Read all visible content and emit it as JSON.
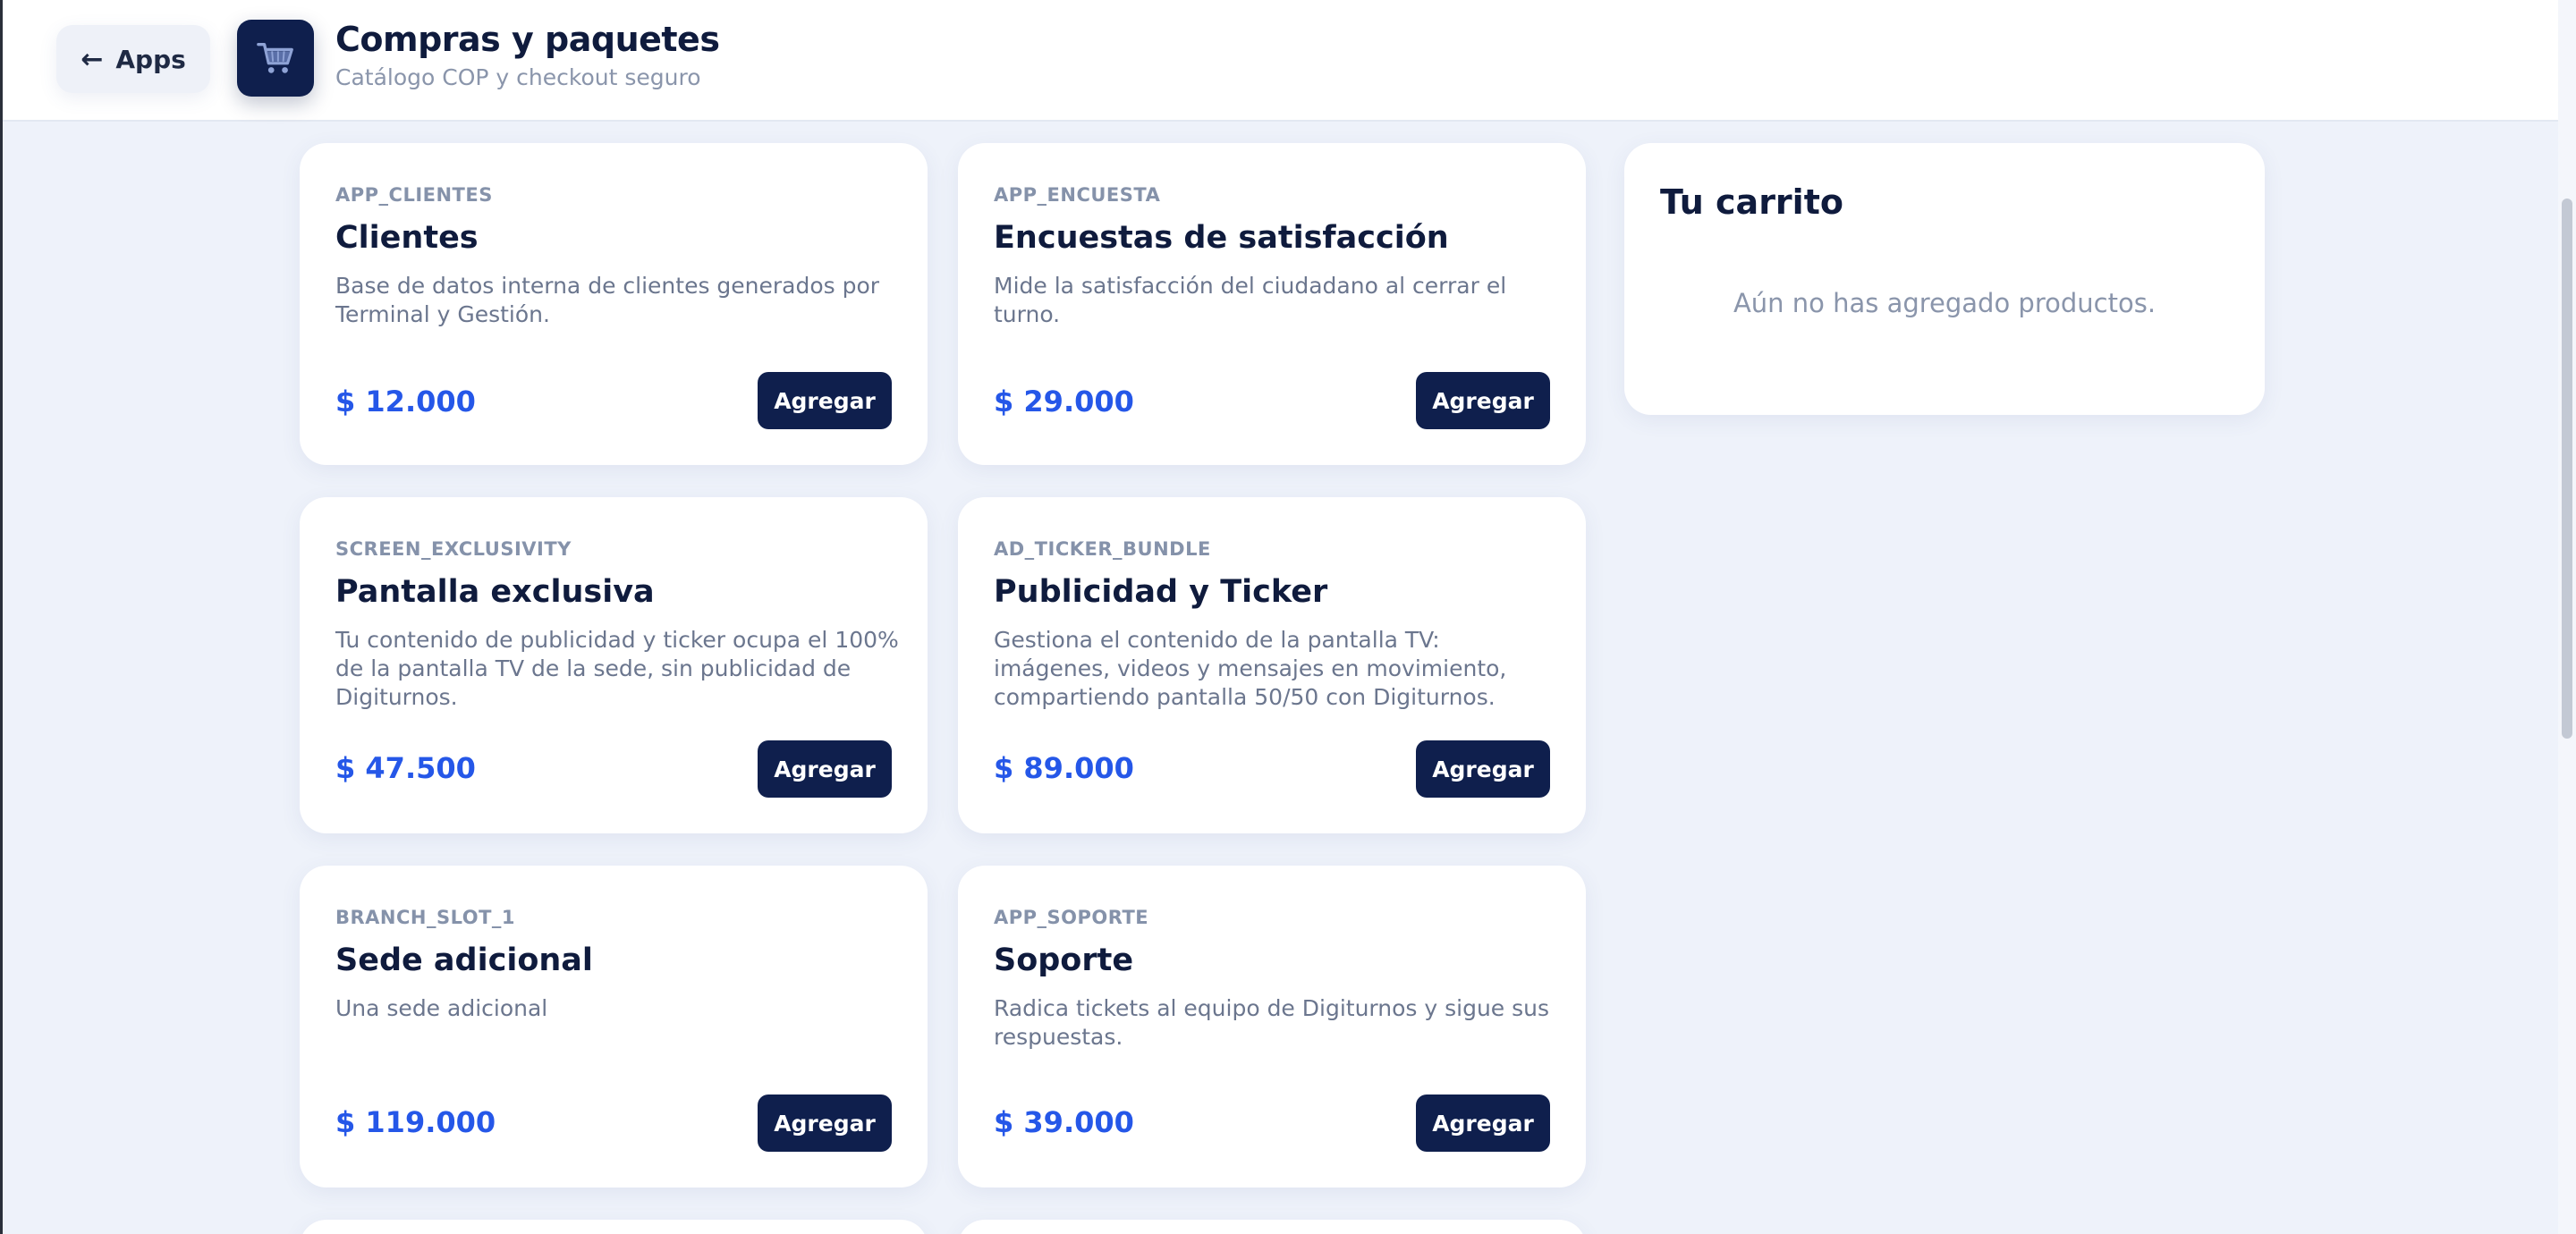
{
  "header": {
    "back_label": "Apps",
    "title": "Compras y paquetes",
    "subtitle": "Catálogo COP y checkout seguro"
  },
  "products": [
    {
      "code": "APP_CLIENTES",
      "name": "Clientes",
      "description": "Base de datos interna de clientes generados por Terminal y Gestión.",
      "price": "$ 12.000",
      "button": "Agregar"
    },
    {
      "code": "APP_ENCUESTA",
      "name": "Encuestas de satisfacción",
      "description": "Mide la satisfacción del ciudadano al cerrar el turno.",
      "price": "$ 29.000",
      "button": "Agregar"
    },
    {
      "code": "SCREEN_EXCLUSIVITY",
      "name": "Pantalla exclusiva",
      "description": "Tu contenido de publicidad y ticker ocupa el 100% de la pantalla TV de la sede, sin publicidad de Digiturnos.",
      "price": "$ 47.500",
      "button": "Agregar"
    },
    {
      "code": "AD_TICKER_BUNDLE",
      "name": "Publicidad y Ticker",
      "description": "Gestiona el contenido de la pantalla TV: imágenes, videos y mensajes en movimiento, compartiendo pantalla 50/50 con Digiturnos.",
      "price": "$ 89.000",
      "button": "Agregar"
    },
    {
      "code": "BRANCH_SLOT_1",
      "name": "Sede adicional",
      "description": "Una sede adicional",
      "price": "$ 119.000",
      "button": "Agregar"
    },
    {
      "code": "APP_SOPORTE",
      "name": "Soporte",
      "description": "Radica tickets al equipo de Digiturnos y sigue sus respuestas.",
      "price": "$ 39.000",
      "button": "Agregar"
    }
  ],
  "cart": {
    "title": "Tu carrito",
    "empty_message": "Aún no has agregado productos."
  },
  "icons": {
    "back": "arrow-left-icon",
    "app": "shopping-cart-icon"
  },
  "colors": {
    "primary_button": "#0f1f4d",
    "price": "#2557e8",
    "background": "#eef2fa"
  }
}
